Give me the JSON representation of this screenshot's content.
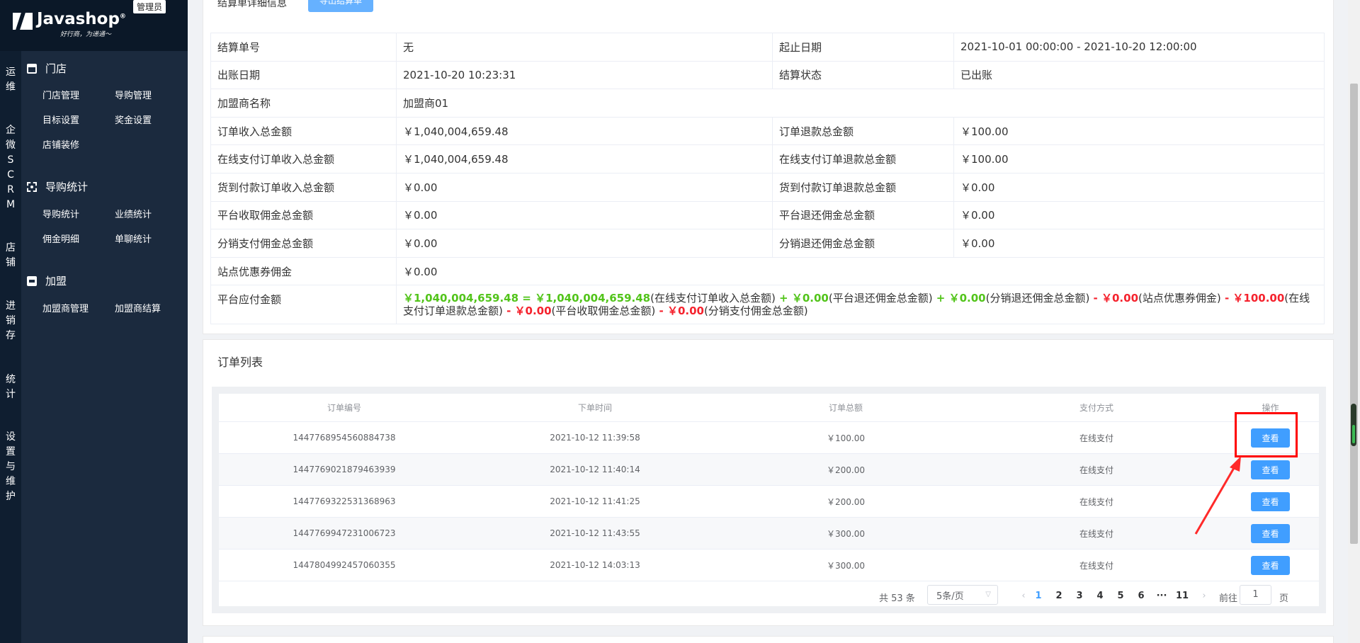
{
  "logo": {
    "brand": "Javashop",
    "reg": "®",
    "slogan": "好行商，为递通～",
    "badge": "管理员"
  },
  "rail": [
    {
      "id": "ops",
      "label": "运维"
    },
    {
      "id": "scrm",
      "label": "企微SCRM"
    },
    {
      "id": "shop",
      "label": "店铺"
    },
    {
      "id": "inventory",
      "label": "进销存"
    },
    {
      "id": "stats",
      "label": "统计"
    },
    {
      "id": "settings",
      "label": "设置与维护"
    }
  ],
  "sidebar": {
    "store": {
      "title": "门店",
      "items": [
        "门店管理",
        "导购管理",
        "目标设置",
        "奖金设置",
        "店铺装修"
      ]
    },
    "guide_stats": {
      "title": "导购统计",
      "items": [
        "导购统计",
        "业绩统计",
        "佣金明细",
        "单聊统计"
      ]
    },
    "join": {
      "title": "加盟",
      "items": [
        "加盟商管理",
        "加盟商结算"
      ]
    }
  },
  "detail": {
    "title": "结算单详细信息",
    "export_label": "导出结算单",
    "rows": {
      "r1": {
        "k1": "结算单号",
        "v1": "无",
        "k2": "起止日期",
        "v2": "2021-10-01 00:00:00 - 2021-10-20 12:00:00"
      },
      "r2": {
        "k1": "出账日期",
        "v1": "2021-10-20 10:23:31",
        "k2": "结算状态",
        "v2": "已出账"
      },
      "r3": {
        "k1": "加盟商名称",
        "v1": "加盟商01"
      },
      "r4": {
        "k1": "订单收入总金额",
        "v1": "￥1,040,004,659.48",
        "k2": "订单退款总金额",
        "v2": "￥100.00"
      },
      "r5": {
        "k1": "在线支付订单收入总金额",
        "v1": "￥1,040,004,659.48",
        "k2": "在线支付订单退款总金额",
        "v2": "￥100.00"
      },
      "r6": {
        "k1": "货到付款订单收入总金额",
        "v1": "￥0.00",
        "k2": "货到付款订单退款总金额",
        "v2": "￥0.00"
      },
      "r7": {
        "k1": "平台收取佣金总金额",
        "v1": "￥0.00",
        "k2": "平台退还佣金总金额",
        "v2": "￥0.00"
      },
      "r8": {
        "k1": "分销支付佣金总金额",
        "v1": "￥0.00",
        "k2": "分销退还佣金总金额",
        "v2": "￥0.00"
      },
      "r9": {
        "k1": "站点优惠券佣金",
        "v1": "￥0.00"
      },
      "r10": {
        "k1": "平台应付金额",
        "f": {
          "a0": "￥1,040,004,659.48",
          "eq": " = ",
          "a1": "￥1,040,004,659.48",
          "t1": "(在线支付订单收入总金额)",
          "p1": " + ",
          "a2": "￥0.00",
          "t2": "(平台退还佣金总金额)",
          "p2": " + ",
          "a3": "￥0.00",
          "t3": "(分销退还佣金总金额)",
          "m1": " - ",
          "a4": "￥0.00",
          "t4": "(站点优惠券佣金)",
          "m2": " - ",
          "a5": "￥100.00",
          "t5": "(在线支付订单退款总金额)",
          "m3": " - ",
          "a6": "￥0.00",
          "t6": "(平台收取佣金总金额)",
          "m4": " - ",
          "a7": "￥0.00",
          "t7": "(分销支付佣金总金额)"
        }
      }
    }
  },
  "orders": {
    "title": "订单列表",
    "headers": {
      "sn": "订单编号",
      "time": "下单时间",
      "total": "订单总额",
      "pay": "支付方式",
      "op": "操作"
    },
    "rows": [
      {
        "sn": "1447768954560884738",
        "time": "2021-10-12 11:39:58",
        "total": "￥100.00",
        "pay": "在线支付",
        "op": "查看"
      },
      {
        "sn": "1447769021879463939",
        "time": "2021-10-12 11:40:14",
        "total": "￥200.00",
        "pay": "在线支付",
        "op": "查看"
      },
      {
        "sn": "1447769322531368963",
        "time": "2021-10-12 11:41:25",
        "total": "￥200.00",
        "pay": "在线支付",
        "op": "查看"
      },
      {
        "sn": "1447769947231006723",
        "time": "2021-10-12 11:43:55",
        "total": "￥300.00",
        "pay": "在线支付",
        "op": "查看"
      },
      {
        "sn": "1447804992457060355",
        "time": "2021-10-12 14:03:13",
        "total": "￥300.00",
        "pay": "在线支付",
        "op": "查看"
      }
    ],
    "pager": {
      "total": "共 53 条",
      "size": "5条/页",
      "pages": [
        "1",
        "2",
        "3",
        "4",
        "5",
        "6",
        "···",
        "11"
      ],
      "prev": "‹",
      "next": "›",
      "goto": "前往",
      "goto_value": "1",
      "goto_unit": "页"
    }
  },
  "colors": {
    "accent": "#409eff",
    "sidebar": "#1b2a3e",
    "positive": "#52c41a",
    "negative": "#f5222d",
    "annotation": "#ff0000"
  }
}
